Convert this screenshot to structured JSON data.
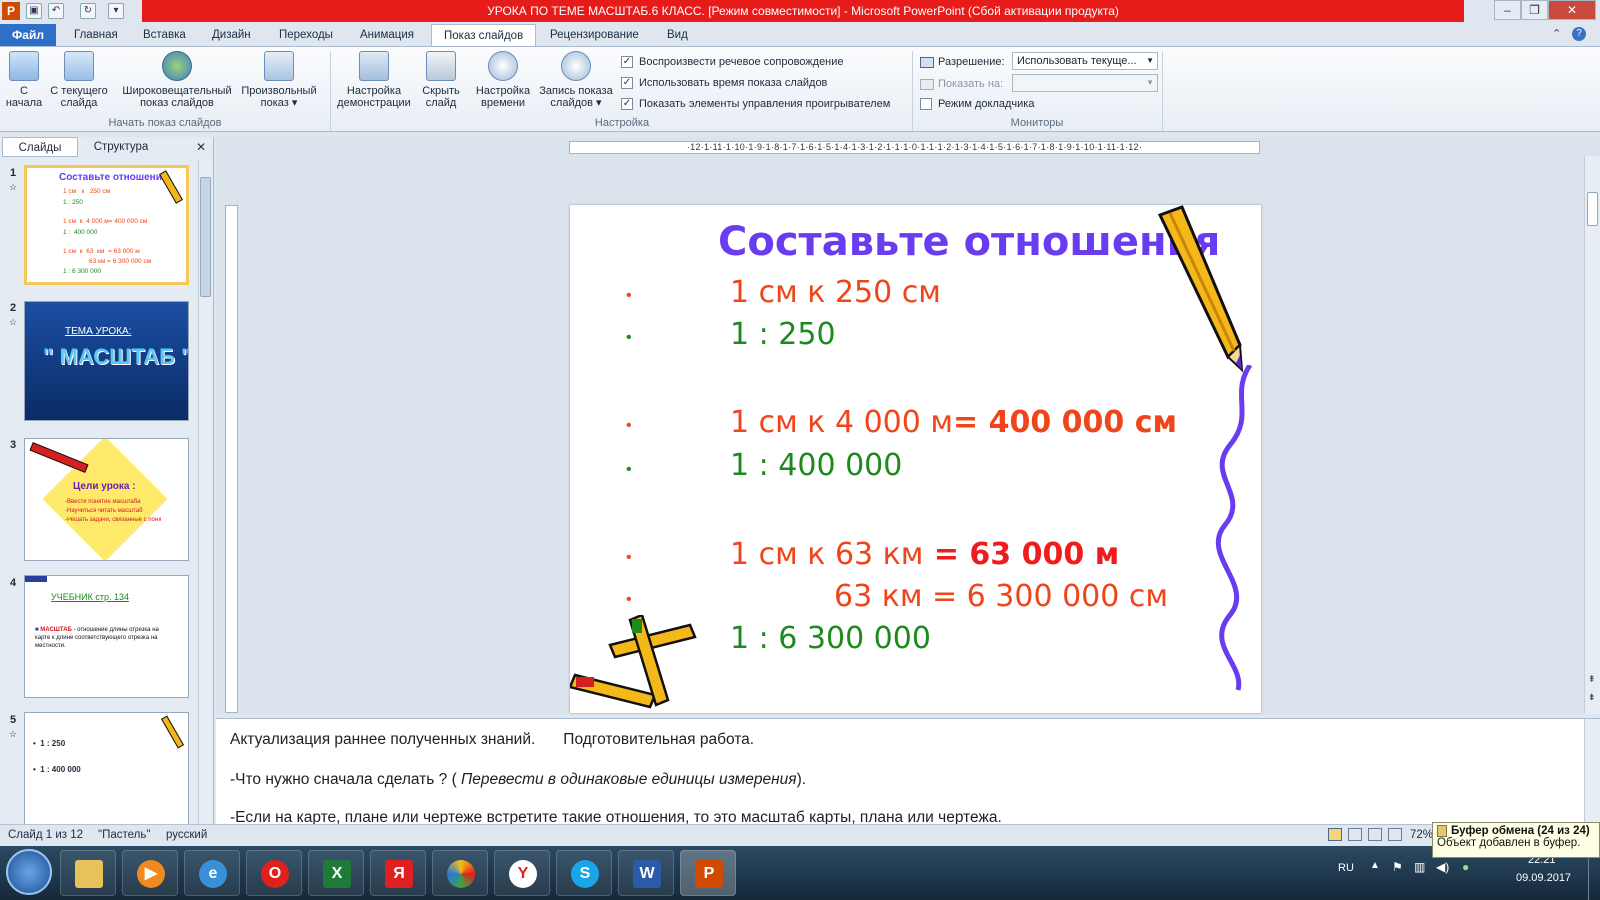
{
  "window": {
    "title": "УРОКА ПО ТЕМЕ МАСШТАБ.6 КЛАСС. [Режим совместимости]  -  Microsoft PowerPoint (Сбой активации продукта)",
    "app_badge": "P"
  },
  "tabs": {
    "file": "Файл",
    "items": [
      "Главная",
      "Вставка",
      "Дизайн",
      "Переходы",
      "Анимация",
      "Показ слайдов",
      "Рецензирование",
      "Вид"
    ],
    "active": "Показ слайдов"
  },
  "ribbon": {
    "start": {
      "group_label": "Начать показ слайдов",
      "buttons": [
        "С\nначала",
        "С текущего\nслайда",
        "Широковещательный\nпоказ слайдов",
        "Произвольный\nпоказ ▾"
      ]
    },
    "setup": {
      "group_label": "Настройка",
      "buttons": [
        "Настройка\nдемонстрации",
        "Скрыть\nслайд",
        "Настройка\nвремени",
        "Запись показа\nслайдов ▾"
      ],
      "checks": [
        {
          "label": "Воспроизвести речевое сопровождение",
          "checked": true
        },
        {
          "label": "Использовать время показа слайдов",
          "checked": true
        },
        {
          "label": "Показать элементы управления проигрывателем",
          "checked": true
        }
      ]
    },
    "monitors": {
      "group_label": "Мониторы",
      "resolution_label": "Разрешение:",
      "resolution_value": "Использовать текуще...",
      "show_on_label": "Показать на:",
      "show_on_value": "",
      "presenter_label": "Режим докладчика",
      "presenter_checked": false
    }
  },
  "left_pane": {
    "tabs": [
      "Слайды",
      "Структура"
    ],
    "slides": [
      {
        "num": "1",
        "title": "Составьте отношения",
        "lines": [
          "1 см   к   250 см",
          "1 : 250",
          "1 см  к  4 000 м= 400 000 см",
          "1 :  400 000",
          "1 см  к  63  км  = 63 000 м",
          "63 км = 6 300 000 см",
          "1 : 6 300 000"
        ]
      },
      {
        "num": "2",
        "line1": "ТЕМА  УРОКА:",
        "line2": "\" МАСШТАБ \""
      },
      {
        "num": "3",
        "title": "Цели урока :",
        "lines": [
          "-Ввести понятие масштаба",
          "-Научиться читать масштаб",
          "-Решать задачи, связанные с понятием масштаба"
        ]
      },
      {
        "num": "4",
        "title": "УЧЕБНИК  стр. 134",
        "term": "МАСШТАБ",
        "text": " - отношение длины отрезка на карте к длине соответствующего отрезка на местности."
      },
      {
        "num": "5",
        "lines": [
          "1 : 250",
          "1 : 400 000"
        ]
      }
    ]
  },
  "slide": {
    "title": "Составьте отношения",
    "lines": [
      {
        "text": "1 см    к    250 см",
        "color": "#f0451a"
      },
      {
        "text": "1  : 250",
        "color": "#1e8a1e"
      },
      {
        "text": "1  см   к  4 000  м",
        "color": "#f0451a",
        "extra": "= 400 000 см"
      },
      {
        "text": "1  :   400 000",
        "color": "#1e8a1e"
      },
      {
        "text": "1  см   к   63   км",
        "color": "#f0451a",
        "extra": " = 63 000 м"
      },
      {
        "text": "63  км  =  6  300 000  см",
        "color": "#f0451a"
      },
      {
        "text": "1  : 6  300 000",
        "color": "#1e8a1e"
      }
    ],
    "title_color": "#6a3cf0"
  },
  "ruler": {
    "ticks": "·12·1·11·1·10·1·9·1·8·1·7·1·6·1·5·1·4·1·3·1·2·1·1·1·0·1·1·1·2·1·3·1·4·1·5·1·6·1·7·1·8·1·9·1·10·1·11·1·12·"
  },
  "notes": {
    "line1a": "Актуализация раннее полученных знаний.",
    "line1b": "Подготовительная работа.",
    "line2a": "-Что нужно сначала сделать ? ( ",
    "line2b": "Перевести в одинаковые единицы измерения",
    "line2c": ").",
    "line3": "-Если на карте, плане или чертеже встретите такие отношения, то это масштаб карты, плана или чертежа."
  },
  "status": {
    "slide_info": "Слайд 1 из 12",
    "theme": "\"Пастель\"",
    "language": "русский",
    "zoom": "72%"
  },
  "clipboard": {
    "title": "Буфер обмена (24 из 24)",
    "message": "Объект добавлен в буфер."
  },
  "taskbar": {
    "lang": "RU",
    "time": "22:21",
    "date": "09.09.2017"
  }
}
